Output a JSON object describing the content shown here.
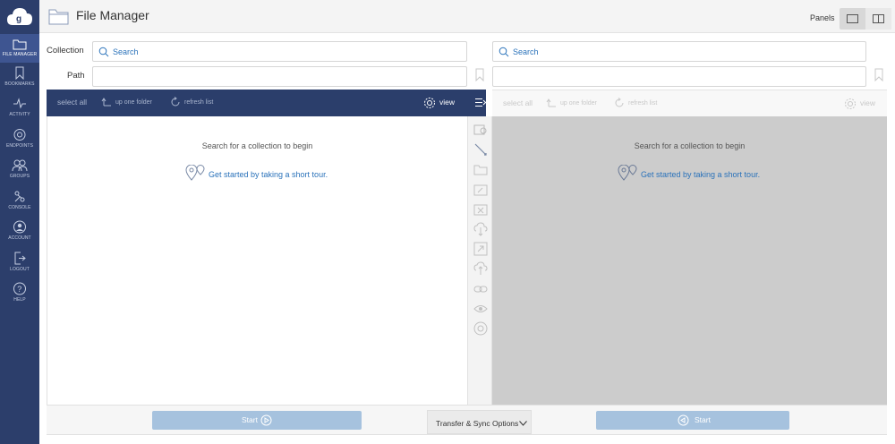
{
  "sidebar": {
    "items": [
      {
        "label": "FILE MANAGER",
        "icon": "folder-icon",
        "active": true
      },
      {
        "label": "BOOKMARKS",
        "icon": "bookmark-icon"
      },
      {
        "label": "ACTIVITY",
        "icon": "activity-icon"
      },
      {
        "label": "ENDPOINTS",
        "icon": "endpoints-icon"
      },
      {
        "label": "GROUPS",
        "icon": "groups-icon"
      },
      {
        "label": "CONSOLE",
        "icon": "console-icon"
      },
      {
        "label": "ACCOUNT",
        "icon": "account-icon"
      },
      {
        "label": "LOGOUT",
        "icon": "logout-icon"
      },
      {
        "label": "HELP",
        "icon": "help-icon"
      }
    ]
  },
  "header": {
    "title": "File Manager",
    "panels_label": "Panels"
  },
  "fields": {
    "collection_label": "Collection",
    "path_label": "Path",
    "left_search_placeholder": "Search",
    "right_search_placeholder": "Search",
    "left_path_value": "",
    "right_path_value": ""
  },
  "toolbar": {
    "select_all": "select all",
    "up_one_folder": "up one folder",
    "refresh_list": "refresh list",
    "view": "view"
  },
  "pane": {
    "empty_message": "Search for a collection to begin",
    "tour_link": "Get started by taking a short tour."
  },
  "footer": {
    "start_label": "Start",
    "options_label": "Transfer & Sync Options"
  },
  "colors": {
    "sidebar": "#2c3e6b",
    "toolbar_active": "#2b3e6b",
    "link": "#2a72ba",
    "inactive_pane": "#cccccc",
    "start_button": "#a6c2de"
  }
}
